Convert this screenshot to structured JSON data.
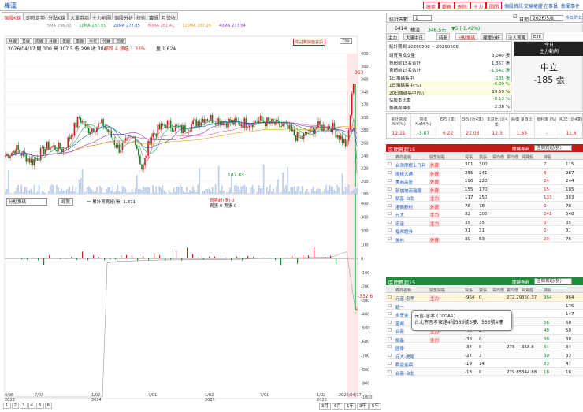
{
  "titlebar": {
    "title": "樺漢",
    "buttons": [
      "庫存",
      "觀察",
      "刪除",
      "主力",
      "關閉"
    ],
    "links": [
      "個股資訊",
      "交易權證",
      "在事員",
      "新聞事件"
    ]
  },
  "tabs": [
    "個股K線",
    "即時走勢",
    "分點K線",
    "大單券商",
    "主力地圖",
    "個股分析",
    "技術",
    "籌碼",
    "月營收"
  ],
  "chart": {
    "mini_tabs": [
      "月線",
      "日線",
      "周線",
      "月線",
      "年線",
      "季線",
      "半年",
      "分鐘",
      "日線"
    ],
    "ma_legend": [
      {
        "label": "5MA",
        "value": "296.00",
        "color": "#888888"
      },
      {
        "label": "10MA",
        "value": "287.93",
        "color": "#1aa34a"
      },
      {
        "label": "20MA",
        "value": "277.85",
        "color": "#1a55b8"
      },
      {
        "label": "60MA",
        "value": "281.41",
        "color": "#e05a9a"
      },
      {
        "label": "120MA",
        "value": "267.26",
        "color": "#e6a21a"
      },
      {
        "label": "40MA",
        "value": "277.04",
        "color": "#7a3bc2"
      }
    ],
    "ohlc_line": "2026/04/17 開 300  高 307.5  低 298  收 304",
    "change_text": "漲跌 4  漲幅 1.33%",
    "volume_text": "量 1,624",
    "badge": "附註數據面資訊",
    "zoom": "750",
    "price_axis": [
      "400",
      "380",
      "360",
      "340",
      "320",
      "300",
      "280",
      "260",
      "240",
      "220",
      "200",
      "180"
    ],
    "high_label": "363",
    "low_label": "187.83",
    "lower_select": "分點籌碼",
    "lower_btn": "總覽",
    "lower_legend1": "一 累計買賣超(張) 1,371",
    "lower_legend2": "買賣超(張) 0",
    "lower_legend3": "買張 0  賣張 0",
    "lower_axis": [
      "400",
      "300",
      "200",
      "100",
      "0",
      "-100",
      "-200",
      "-300",
      "-400",
      "-500",
      "-600",
      "-700",
      "-800",
      "-900",
      "-1000"
    ],
    "lower_value": "-332.6",
    "x_labels": [
      "4/98",
      "7/03",
      "1/02",
      "7/01",
      "1/02",
      "7/01",
      "1/02",
      "2026/04/17"
    ],
    "x_years": [
      "2023",
      "2024",
      "2025",
      "2026"
    ],
    "pages": [
      "1",
      "2",
      "3",
      "4",
      "5",
      "6"
    ],
    "periods": [
      "3月",
      "6月",
      "1年",
      "3年",
      "5年"
    ]
  },
  "right": {
    "period_label": "統計天數",
    "period_value": "1",
    "date_label": "日期",
    "date_value": "2026/5/8",
    "checks": [
      "今日",
      "昨日",
      "前日"
    ],
    "stock_code": "6414",
    "stock_name": "樺漢",
    "price": "346.5元",
    "change": "▼5 (-1.42%)",
    "subtabs": [
      "主力",
      "大事中日",
      "時間",
      "分點籌碼",
      "權證分析",
      "法人買賣",
      "ETF"
    ],
    "stats_period": "統計期間  20260508 ~ 20260508",
    "stats": [
      {
        "label": "總買賣成交量",
        "value": "3,040 張"
      },
      {
        "label": "買超前15名合計",
        "value": "1,357 張"
      },
      {
        "label": "賣超前15名合計",
        "value": "-1,542 張"
      },
      {
        "label": "1日籌碼集中",
        "value": "-185 張"
      },
      {
        "label": "1日籌碼集中(%)",
        "value": "-6.09 %"
      },
      {
        "label": "20日籌碼集中(%)",
        "value": "19.59 %"
      },
      {
        "label": "佔股本比重",
        "value": "-0.13 %"
      },
      {
        "label": "籌碼周轉率",
        "value": "2.08 %"
      }
    ],
    "today": {
      "head1": "今日",
      "head2": "主力動向",
      "state": "中立",
      "value": "-185 張"
    },
    "metrics": [
      {
        "label": "累計營收 YoY(%)",
        "value": "12.21"
      },
      {
        "label": "營收 MoM(%)",
        "value": "-3.87"
      },
      {
        "label": "EPS (季)",
        "value": "6.22"
      },
      {
        "label": "EPS (近4季)",
        "value": "22.03"
      },
      {
        "label": "本益比 (近4季)",
        "value": "12.3"
      },
      {
        "label": "股價 淨值比",
        "value": "1.83"
      },
      {
        "label": "殖利率 (%)",
        "value": "-"
      },
      {
        "label": "ROE (近4季)",
        "value": "11.6"
      }
    ],
    "buy": {
      "title": "區間買超15",
      "filter": "關鍵券商",
      "select": "區間買超(張)",
      "cols": [
        "券商名稱",
        "營業據點",
        "買張",
        "賣張",
        "買均價",
        "賣均價",
        "買賣超",
        "持股"
      ],
      "rows": [
        {
          "name": "台灣摩根士丹利",
          "tag": "外資",
          "b": "301",
          "s": "300",
          "n": "7",
          "p": "115"
        },
        {
          "name": "摩根大通",
          "tag": "外資",
          "b": "255",
          "s": "241",
          "n": "6",
          "p": "287"
        },
        {
          "name": "美商高盛",
          "tag": "外資",
          "b": "196",
          "s": "220",
          "n": "24",
          "p": "244"
        },
        {
          "name": "新加坡商瑞銀",
          "tag": "外資",
          "b": "155",
          "s": "170",
          "n": "15",
          "p": "185"
        },
        {
          "name": "凱基-台北",
          "tag": "主力",
          "b": "117",
          "s": "250",
          "n": "133",
          "p": "383"
        },
        {
          "name": "港商野村",
          "tag": "外資",
          "b": "78",
          "s": "78",
          "n": "0",
          "p": "78"
        },
        {
          "name": "元大",
          "tag": "主力",
          "b": "82",
          "s": "305",
          "n": "241",
          "p": "548"
        },
        {
          "name": "宏遠",
          "tag": "主力",
          "b": "35",
          "s": "35",
          "n": "0",
          "p": "35"
        },
        {
          "name": "福邦證券",
          "tag": "",
          "b": "31",
          "s": "31",
          "n": "0",
          "p": "31"
        },
        {
          "name": "美林",
          "tag": "外資",
          "b": "30",
          "s": "53",
          "n": "23",
          "p": "76"
        }
      ]
    },
    "sell": {
      "title": "區間賣超15",
      "filter": "關鍵券商",
      "select": "區間賣超(張)",
      "rows": [
        {
          "name": "元富-忠孝",
          "tag": "主力",
          "b": "-964",
          "s": "0",
          "n": "964",
          "a": "272.29",
          "c": "350.37",
          "p": "964"
        },
        {
          "name": "統一",
          "tag": "",
          "b": "",
          "s": "",
          "n": "",
          "a": "",
          "c": "",
          "p": "175"
        },
        {
          "name": "永豐金",
          "tag": "",
          "b": "",
          "s": "",
          "n": "",
          "a": "",
          "c": "",
          "p": "147"
        },
        {
          "name": "富邦",
          "tag": "主力",
          "b": "-52",
          "s": "4",
          "n": "56",
          "a": "",
          "c": "",
          "p": "60"
        },
        {
          "name": "台新",
          "tag": "主力",
          "b": "-46",
          "s": "2",
          "n": "48",
          "a": "",
          "c": "",
          "p": "50"
        },
        {
          "name": "凱基",
          "tag": "主力",
          "b": "-38",
          "s": "0",
          "n": "38",
          "a": "",
          "c": "",
          "p": "38"
        },
        {
          "name": "國泰",
          "tag": "",
          "b": "-34",
          "s": "0",
          "n": "34",
          "a": "278",
          "c": "358.8",
          "p": "34"
        },
        {
          "name": "元大-虎尾",
          "tag": "",
          "b": "-27",
          "s": "3",
          "n": "30",
          "a": "",
          "c": "",
          "p": "33"
        },
        {
          "name": "群益金鼎",
          "tag": "",
          "b": "-19",
          "s": "14",
          "n": "33",
          "a": "",
          "c": "",
          "p": "47"
        },
        {
          "name": "台新-台北",
          "tag": "",
          "b": "-18",
          "s": "0",
          "n": "18",
          "a": "279.85",
          "c": "344.88",
          "p": "18"
        }
      ]
    },
    "tooltip": {
      "line1": "元富-忠孝 (700A1)",
      "line2": "台北市忠孝東路4段563號3樓、565號4樓"
    }
  },
  "colors": {
    "up": "#d41f1f",
    "down": "#0a8a2a",
    "buy_header": "#c41a1a",
    "sell_header": "#1f8a3a",
    "accent": "#1a55b8"
  }
}
